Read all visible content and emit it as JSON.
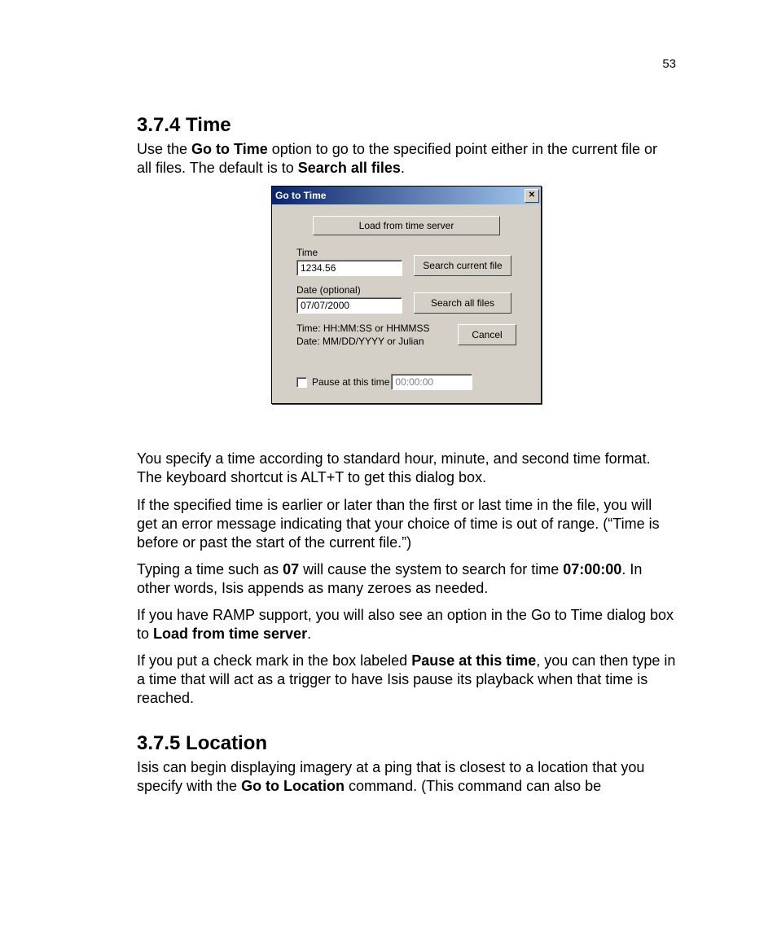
{
  "page_number": "53",
  "section_time": {
    "heading": "3.7.4 Time",
    "intro_pre": "Use the ",
    "intro_b1": "Go to Time",
    "intro_mid": " option to go to the specified point either in the current file or all files. The default is to ",
    "intro_b2": "Search all files",
    "intro_end": ".",
    "p2": "You specify a time according to standard hour, minute, and second time format. The keyboard shortcut is ALT+T to get this dialog box.",
    "p3": "If the specified time is earlier or later than the first or last time in the file, you will get an error message indicating that your choice of time is out of range. (“Time is before or past the start of the current file.”)",
    "p4_pre": "Typing a time such as ",
    "p4_b1": "07",
    "p4_mid": " will cause the system to search for time ",
    "p4_b2": "07:00:00",
    "p4_end": ". In other words, Isis appends as many zeroes as needed.",
    "p5_pre": "If you have RAMP support, you will also see an option in the Go to Time dialog box to ",
    "p5_b1": "Load from time server",
    "p5_end": ".",
    "p6_pre": "If you put a check mark in the box labeled ",
    "p6_b1": "Pause at this time",
    "p6_end": ", you can then type in a time that will act as a trigger to have Isis pause its playback when that time is reached."
  },
  "section_location": {
    "heading": "3.7.5 Location",
    "p1_pre": "Isis can begin displaying imagery at a ping that is closest to a location that you specify with the ",
    "p1_b1": "Go to Location",
    "p1_end": " command. (This command can also be"
  },
  "dialog": {
    "title": "Go to Time",
    "load_button": "Load from time server",
    "time_label": "Time",
    "time_value": "1234.56",
    "search_current": "Search current file",
    "date_label": "Date (optional)",
    "date_value": "07/07/2000",
    "search_all": "Search all files",
    "hint_line1": "Time: HH:MM:SS or HHMMSS",
    "hint_line2": "Date: MM/DD/YYYY or Julian",
    "cancel": "Cancel",
    "pause_label": "Pause at this time",
    "pause_value": "00:00:00"
  }
}
